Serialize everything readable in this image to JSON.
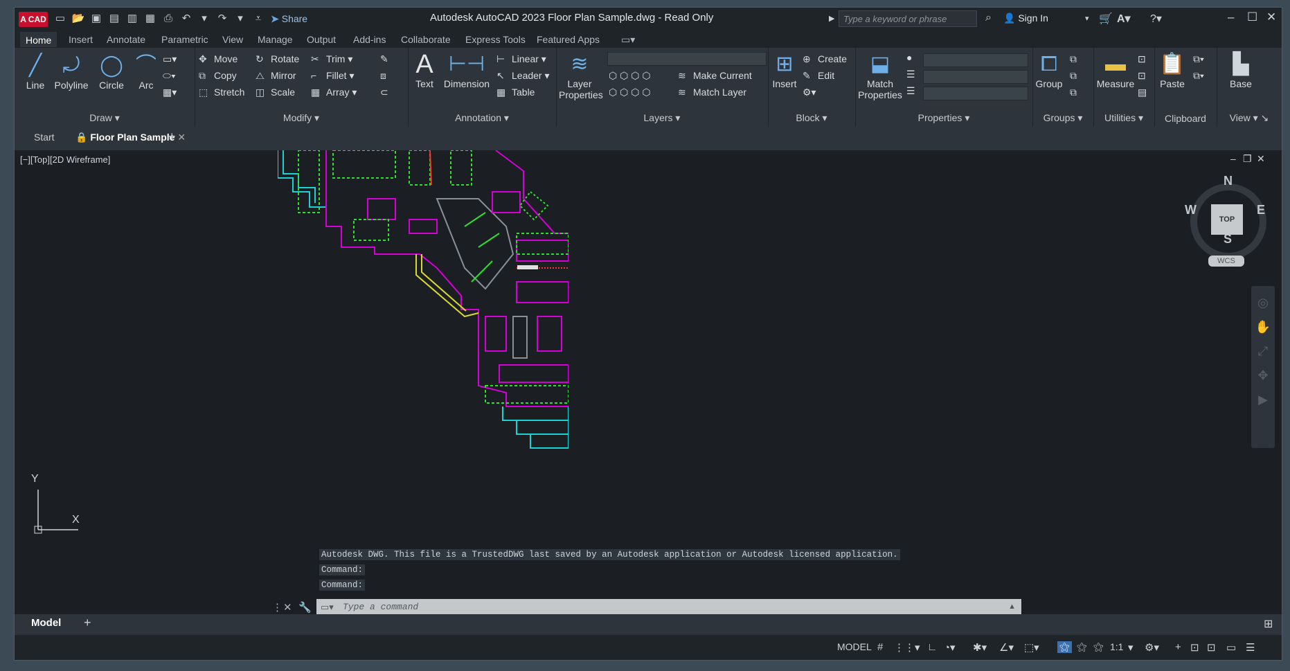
{
  "app": {
    "logo_text": "A CAD",
    "title": "Autodesk AutoCAD 2023     Floor Plan Sample.dwg - Read Only",
    "share_label": "Share",
    "search_placeholder": "Type a keyword or phrase",
    "signin_label": "Sign In"
  },
  "ribbon_tabs": [
    "Home",
    "Insert",
    "Annotate",
    "Parametric",
    "View",
    "Manage",
    "Output",
    "Add-ins",
    "Collaborate",
    "Express Tools",
    "Featured Apps"
  ],
  "ribbon": {
    "draw": {
      "label": "Draw",
      "line": "Line",
      "polyline": "Polyline",
      "circle": "Circle",
      "arc": "Arc"
    },
    "modify": {
      "label": "Modify",
      "move": "Move",
      "rotate": "Rotate",
      "trim": "Trim",
      "copy": "Copy",
      "mirror": "Mirror",
      "fillet": "Fillet",
      "stretch": "Stretch",
      "scale": "Scale",
      "array": "Array"
    },
    "annotation": {
      "label": "Annotation",
      "text": "Text",
      "dimension": "Dimension",
      "linear": "Linear",
      "leader": "Leader",
      "table": "Table"
    },
    "layers": {
      "label": "Layers",
      "layer_properties": "Layer Properties",
      "make_current": "Make Current",
      "match_layer": "Match Layer"
    },
    "block": {
      "label": "Block",
      "insert": "Insert",
      "create": "Create",
      "edit": "Edit"
    },
    "properties": {
      "label": "Properties",
      "match_properties": "Match Properties"
    },
    "groups": {
      "label": "Groups",
      "group": "Group"
    },
    "utilities": {
      "label": "Utilities",
      "measure": "Measure"
    },
    "clipboard": {
      "label": "Clipboard",
      "paste": "Paste"
    },
    "view": {
      "label": "View",
      "base": "Base"
    }
  },
  "doc_tabs": {
    "start": "Start",
    "active": "Floor Plan Sample"
  },
  "viewport": {
    "label": "[−][Top][2D Wireframe]",
    "viewcube": {
      "n": "N",
      "s": "S",
      "e": "E",
      "w": "W",
      "top": "TOP",
      "wcs": "WCS"
    }
  },
  "command": {
    "history": [
      "Autodesk DWG.  This file is a TrustedDWG last saved by an Autodesk application or Autodesk licensed application.",
      "Command:",
      "Command:"
    ],
    "placeholder": "Type a command"
  },
  "ucs": {
    "x": "X",
    "y": "Y"
  },
  "layout_tabs": {
    "model": "Model"
  },
  "status": {
    "model": "MODEL",
    "scale": "1:1"
  },
  "colors": {
    "accent": "#3a6fb0",
    "magenta": "#d400d4",
    "cyan": "#19d3d3",
    "green": "#2ee02e",
    "yellow": "#d9d930"
  }
}
